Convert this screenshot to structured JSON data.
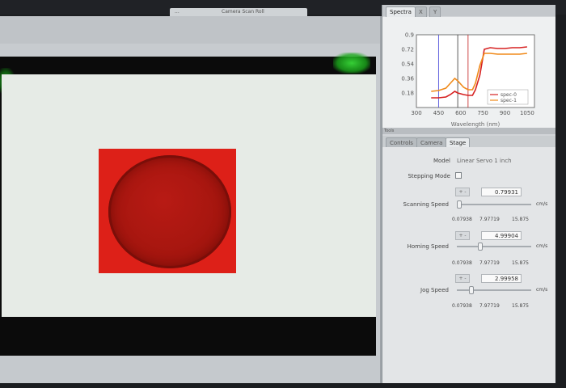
{
  "top_tabs": [
    "...",
    "Camera Scan Roll"
  ],
  "right_tabs": [
    {
      "label": "Spectra",
      "active": true
    },
    {
      "label": "X",
      "active": false
    },
    {
      "label": "Y",
      "active": false
    }
  ],
  "plot": {
    "ylabel_ticks": [
      "0.9",
      "0.72",
      "0.54",
      "0.36",
      "0.18"
    ],
    "xlabel_ticks": [
      "300",
      "450",
      "600",
      "750",
      "900",
      "1050"
    ],
    "xlabel": "Wavelength (nm)",
    "legend": [
      {
        "name": "spec-0",
        "color": "#d62020"
      },
      {
        "name": "spec-1",
        "color": "#f08a1a"
      }
    ]
  },
  "chart_data": {
    "type": "line",
    "xlabel": "Wavelength (nm)",
    "ylabel": "",
    "xlim": [
      300,
      1100
    ],
    "ylim": [
      0,
      0.9
    ],
    "vlines": [
      450,
      580,
      650
    ],
    "series": [
      {
        "name": "spec-0",
        "color": "#d62020",
        "x": [
          400,
          450,
          500,
          530,
          560,
          580,
          620,
          650,
          680,
          700,
          730,
          760,
          800,
          850,
          900,
          950,
          1000,
          1050
        ],
        "y": [
          0.12,
          0.12,
          0.13,
          0.16,
          0.2,
          0.18,
          0.16,
          0.15,
          0.15,
          0.22,
          0.4,
          0.72,
          0.74,
          0.73,
          0.73,
          0.74,
          0.74,
          0.75
        ]
      },
      {
        "name": "spec-1",
        "color": "#f08a1a",
        "x": [
          400,
          450,
          500,
          530,
          560,
          580,
          620,
          650,
          680,
          700,
          730,
          760,
          800,
          850,
          900,
          950,
          1000,
          1050
        ],
        "y": [
          0.2,
          0.21,
          0.24,
          0.3,
          0.36,
          0.33,
          0.25,
          0.22,
          0.22,
          0.3,
          0.52,
          0.67,
          0.67,
          0.66,
          0.66,
          0.66,
          0.66,
          0.67
        ]
      }
    ]
  },
  "tools_header": "Tools",
  "tools_tabs": [
    {
      "label": "Controls",
      "active": false
    },
    {
      "label": "Camera",
      "active": false
    },
    {
      "label": "Stage",
      "active": true
    }
  ],
  "stage": {
    "model_label": "Model",
    "model_value": "Linear Servo 1 inch",
    "stepping_label": "Stepping Mode",
    "stepping_checked": false,
    "unit": "cm/s",
    "scale": {
      "min": "0.07938",
      "mid": "7.97719",
      "max": "15.875"
    },
    "speeds": [
      {
        "label": "Scanning Speed",
        "value": "0.79931",
        "fraction": 0.0
      },
      {
        "label": "Homing Speed",
        "value": "4.99904",
        "fraction": 0.3
      },
      {
        "label": "Jog Speed",
        "value": "2.99958",
        "fraction": 0.18
      }
    ]
  }
}
